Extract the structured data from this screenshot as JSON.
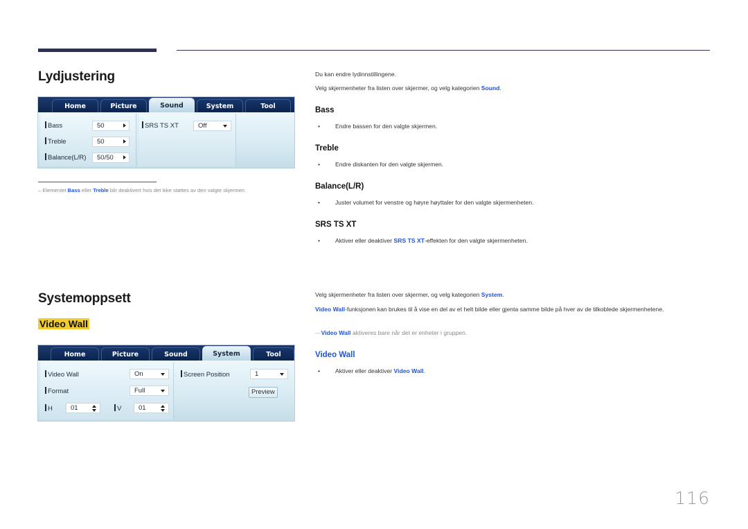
{
  "page": {
    "number": "116"
  },
  "sound_section": {
    "title": "Lydjustering",
    "intro_1": "Du kan endre lydinnstillingene.",
    "intro_2_pre": "Velg skjermenheter fra listen over skjermer, og velg kategorien ",
    "intro_2_link": "Sound",
    "intro_2_post": ".",
    "panel": {
      "tabs": [
        "Home",
        "Picture",
        "Sound",
        "System",
        "Tool"
      ],
      "active_tab": "Sound",
      "fields": [
        {
          "label": "Bass",
          "value": "50",
          "control": "arrow-right"
        },
        {
          "label": "Treble",
          "value": "50",
          "control": "arrow-right"
        },
        {
          "label": "Balance(L/R)",
          "value": "50/50",
          "control": "arrow-right"
        },
        {
          "label": "SRS TS XT",
          "value": "Off",
          "control": "dropdown"
        }
      ]
    },
    "footnote": {
      "dash": "–",
      "pre": " Elementet ",
      "link1": "Bass",
      "mid": " eller ",
      "link2": "Treble",
      "post": " blir deaktivert hvis det ikke støttes av den valgte skjermen."
    },
    "items": [
      {
        "heading": "Bass",
        "bullet": "Endre bassen for den valgte skjermen."
      },
      {
        "heading": "Treble",
        "bullet": "Endre diskanten for den valgte skjermen."
      },
      {
        "heading": "Balance(L/R)",
        "bullet": "Juster volumet for venstre og høyre høyttaler for den valgte skjermenheten."
      },
      {
        "heading": "SRS TS XT",
        "bullet_pre": "Aktiver eller deaktiver ",
        "bullet_link": "SRS TS XT",
        "bullet_post": "-effekten for den valgte skjermenheten."
      }
    ]
  },
  "system_section": {
    "title": "Systemoppsett",
    "subtitle": "Video Wall",
    "intro_1_pre": "Velg skjermenheter fra listen over skjermer, og velg kategorien ",
    "intro_1_link": "System",
    "intro_1_post": ".",
    "intro_2_link": "Video Wall",
    "intro_2_post": "-funksjonen kan brukes til å vise en del av et helt bilde eller gjenta samme bilde på hver av de tilkoblede skjermenhetene.",
    "note_dash": "—",
    "note_link": "Video Wall",
    "note_post": " aktiveres bare når det er enheter i gruppen.",
    "panel": {
      "tabs": [
        "Home",
        "Picture",
        "Sound",
        "System",
        "Tool"
      ],
      "active_tab": "System",
      "video_wall_label": "Video Wall",
      "video_wall_value": "On",
      "format_label": "Format",
      "format_value": "Full",
      "h_label": "H",
      "h_value": "01",
      "v_label": "V",
      "v_value": "01",
      "screen_position_label": "Screen Position",
      "screen_position_value": "1",
      "preview_button": "Preview"
    },
    "item": {
      "heading": "Video Wall",
      "bullet_pre": "Aktiver eller deaktiver ",
      "bullet_link": "Video Wall",
      "bullet_post": "."
    }
  },
  "bullet_char": "•"
}
